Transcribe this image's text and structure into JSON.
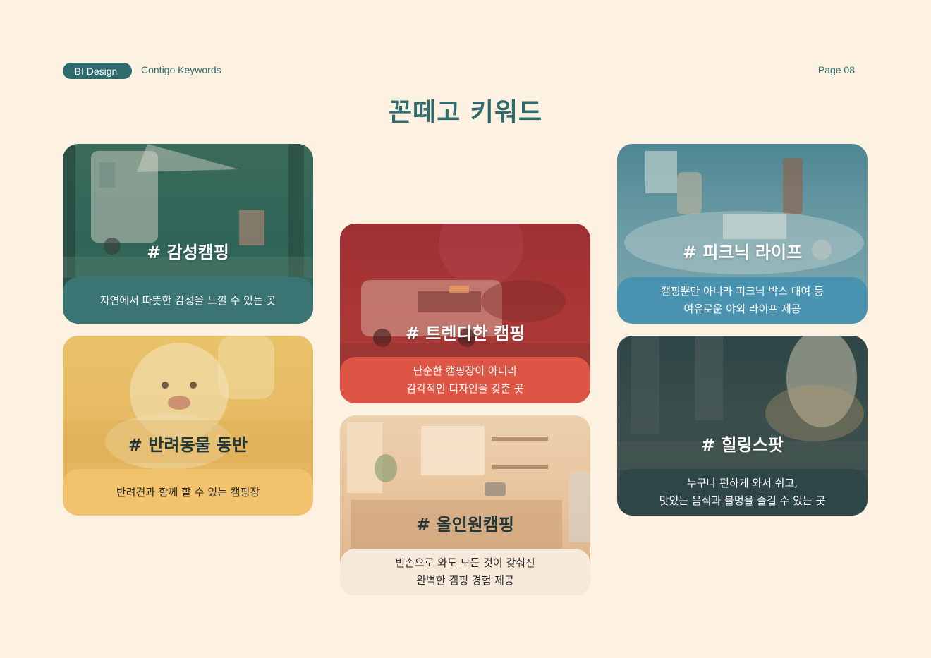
{
  "header": {
    "badge": "BI Design",
    "subtitle": "Contigo Keywords",
    "page": "Page 08"
  },
  "title": "꼰떼고 키워드",
  "cards": [
    {
      "keyword": "# 감성캠핑",
      "lines": [
        "자연에서 따뜻한 감성을 느낄 수 있는 곳"
      ],
      "photo_icon": "camper-van-icon",
      "overlay_color": "#2f6b6c",
      "band_color": "#3a7473"
    },
    {
      "keyword": "# 트렌디한 캠핑",
      "lines": [
        "단순한 캠핑장이 아니라",
        "감각적인 디자인을 갖춘 곳"
      ],
      "photo_icon": "motorhome-icon",
      "overlay_color": "#b83a35",
      "band_color": "#dd5545"
    },
    {
      "keyword": "# 피크닉 라이프",
      "lines": [
        "캠핑뿐만 아니라 피크닉 박스 대여 등",
        "여유로운 야외 라이프 제공"
      ],
      "photo_icon": "picnic-icon",
      "overlay_color": "#4a8a9c",
      "band_color": "#4a93b0"
    },
    {
      "keyword": "# 반려동물 동반",
      "lines": [
        "반려견과 함께 할 수 있는 캠핑장"
      ],
      "photo_icon": "dog-icon",
      "overlay_color": "#e7b55a",
      "band_color": "#f3c26c"
    },
    {
      "keyword": "# 올인원캠핑",
      "lines": [
        "빈손으로 와도 모든 것이 갖춰진",
        "완벽한 캠핑 경험 제공"
      ],
      "photo_icon": "kitchen-icon",
      "overlay_color": "#e9c9a3",
      "band_color": "#f6e9da"
    },
    {
      "keyword": "# 힐링스팟",
      "lines": [
        "누구나 편하게 와서 쉬고,",
        "맛있는 음식과 불멍을 즐길 수 있는 곳"
      ],
      "photo_icon": "campfire-icon",
      "overlay_color": "#2a4042",
      "band_color": "#2f4648"
    }
  ]
}
